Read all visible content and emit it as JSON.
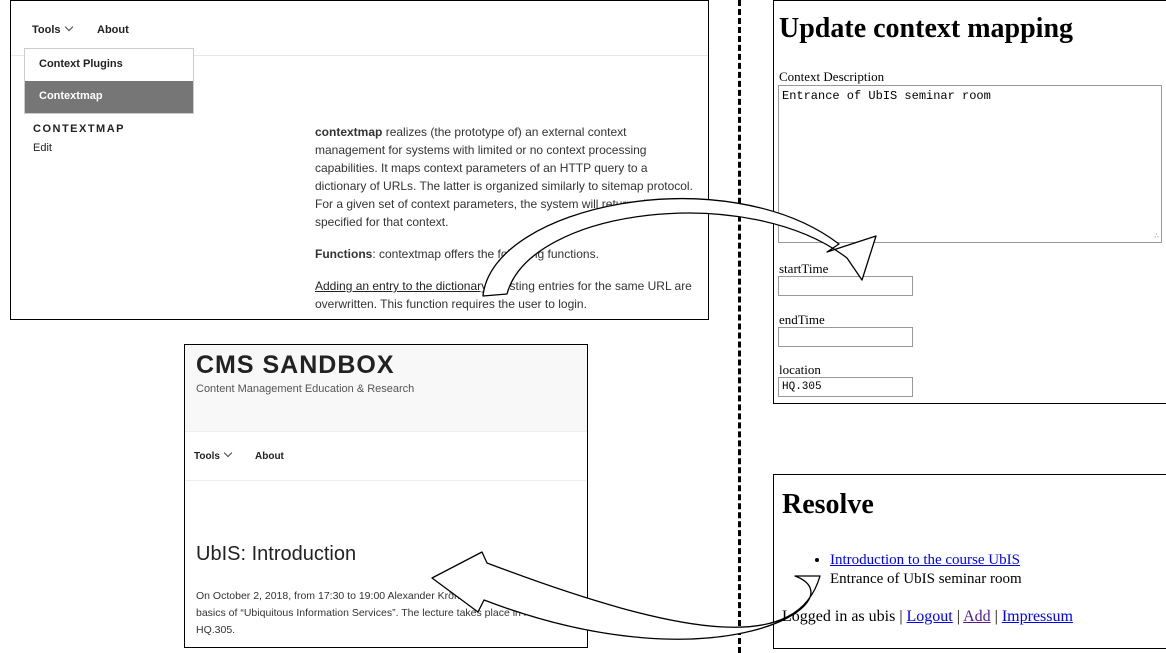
{
  "panel1": {
    "nav": {
      "tools": "Tools",
      "about": "About"
    },
    "dropdown": [
      "Context Plugins",
      "Contextmap"
    ],
    "sidebar": {
      "title": "CONTEXTMAP",
      "edit": "Edit"
    },
    "content": {
      "p1_bold": "contextmap",
      "p1_rest": " realizes (the prototype of) an external context management for systems with limited or no context processing capabilities. It maps context parameters of an HTTP query to a dictionary of URLs. The latter is organized similarly to sitemap protocol. For a given set of context parameters, the system will return all URLs specified for that context.",
      "p2_bold": "Functions",
      "p2_rest": ": contextmap offers the following functions.",
      "p3_link": "Adding an entry to the dictionary",
      "p3_rest": ". Existing entries for the same URL are overwritten. This function requires the user to login."
    }
  },
  "panel2": {
    "site_title": "CMS SANDBOX",
    "site_desc": "Content Management Education & Research",
    "nav": {
      "tools": "Tools",
      "about": "About"
    },
    "post_title": "UbIS: Introduction",
    "post_body": "On October 2, 2018, from 17:30 to 19:00 Alexander Kröner introduces the basics of “Ubiquitous Information Services”. The lecture takes place in room in HQ.305."
  },
  "panel3": {
    "title": "Update context mapping",
    "desc_label": "Context Description",
    "desc_value": "Entrance of UbIS seminar room",
    "start_label": "startTime",
    "start_value": "",
    "end_label": "endTime",
    "end_value": "",
    "location_label": "location",
    "location_value": "HQ.305"
  },
  "panel4": {
    "title": "Resolve",
    "item_link": "Introduction to the course UbIS",
    "item_desc": "Entrance of UbIS seminar room",
    "footer_prefix": "Logged in as ubis |",
    "logout": "Logout",
    "add": "Add",
    "impressum": "Impressum",
    "sep": "|"
  },
  "colors": {
    "link": "#0000ee",
    "visited": "#551a8b",
    "menu_active_bg": "#767676"
  }
}
